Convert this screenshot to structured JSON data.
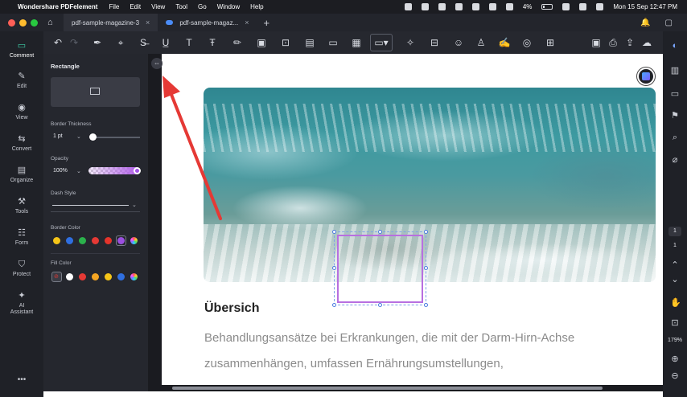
{
  "menubar": {
    "app_name": "Wondershare PDFelement",
    "items": [
      "File",
      "Edit",
      "View",
      "Tool",
      "Go",
      "Window",
      "Help"
    ],
    "battery": "4%",
    "datetime": "Mon 15 Sep  12:47 PM"
  },
  "tabs": [
    {
      "label": "pdf-sample-magazine-3",
      "active": true
    },
    {
      "label": "pdf-sample-magaz...",
      "active": false
    }
  ],
  "leftnav": [
    {
      "label": "Comment",
      "icon": "comment-icon",
      "active": true
    },
    {
      "label": "Edit",
      "icon": "edit-icon"
    },
    {
      "label": "View",
      "icon": "eye-icon"
    },
    {
      "label": "Convert",
      "icon": "convert-icon"
    },
    {
      "label": "Organize",
      "icon": "organize-icon"
    },
    {
      "label": "Tools",
      "icon": "tools-icon"
    },
    {
      "label": "Form",
      "icon": "form-icon"
    },
    {
      "label": "Protect",
      "icon": "shield-icon"
    },
    {
      "label": "AI Assistant",
      "icon": "ai-icon"
    }
  ],
  "panel": {
    "title": "Rectangle",
    "border_thickness_label": "Border Thickness",
    "border_thickness_value": "1 pt",
    "opacity_label": "Opacity",
    "opacity_value": "100%",
    "dash_style_label": "Dash Style",
    "border_color_label": "Border Color",
    "fill_color_label": "Fill Color",
    "border_colors": [
      "#f5c518",
      "#2f6fe0",
      "#2bb24c",
      "#e53935",
      "#e5342b",
      "#9b4fe0",
      "rainbow"
    ],
    "fill_colors": [
      "none",
      "#ffffff",
      "#e53935",
      "#f5a623",
      "#f5c518",
      "#2f6fe0",
      "rainbow"
    ]
  },
  "document": {
    "heading": "Übersich",
    "body_lines": [
      "Behandlungsansätze bei Erkrankungen, die mit der Darm-Hirn-Achse",
      "zusammenhängen, umfassen Ernährungsumstellungen,"
    ]
  },
  "rightbar": {
    "page_current": "1",
    "page_total": "1",
    "zoom": "179%"
  },
  "colors": {
    "accent": "#3fd0a9",
    "annotation": "#b86fe0",
    "arrow": "#e53935"
  }
}
